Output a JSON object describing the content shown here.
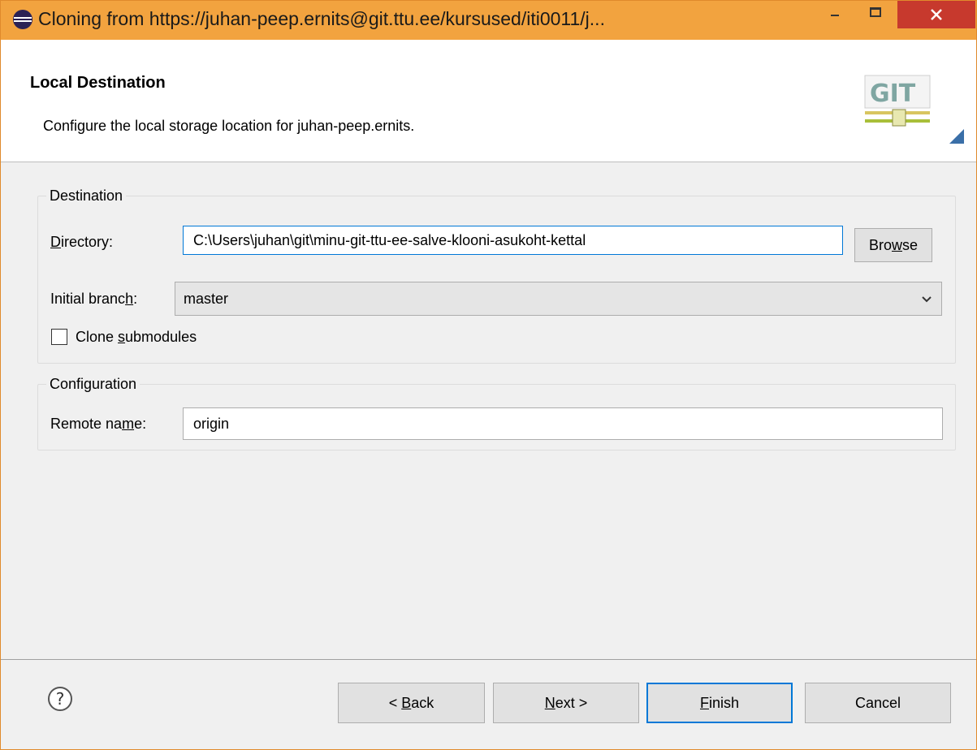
{
  "window": {
    "title": "Cloning from https://juhan-peep.ernits@git.ttu.ee/kursused/iti0011/j...",
    "colors": {
      "titlebar": "#f2a33f",
      "close": "#c7392d",
      "focus": "#0078d7"
    }
  },
  "header": {
    "title": "Local Destination",
    "description": "Configure the local storage location for juhan-peep.ernits.",
    "logo_text": "GIT"
  },
  "destination": {
    "legend": "Destination",
    "directory": {
      "label_pre": "",
      "label_key": "D",
      "label_post": "irectory:",
      "value": "C:\\Users\\juhan\\git\\minu-git-ttu-ee-salve-klooni-asukoht-kettal"
    },
    "browse": {
      "pre": "Bro",
      "key": "w",
      "post": "se"
    },
    "initial_branch": {
      "label_pre": "Initial branc",
      "label_key": "h",
      "label_post": ":",
      "value": "master"
    },
    "clone_submodules": {
      "pre": "Clone ",
      "key": "s",
      "post": "ubmodules",
      "checked": false
    }
  },
  "configuration": {
    "legend": "Configuration",
    "remote_name": {
      "label_pre": "Remote na",
      "label_key": "m",
      "label_post": "e:",
      "value": "origin"
    }
  },
  "buttons": {
    "back": {
      "pre": "< ",
      "key": "B",
      "post": "ack"
    },
    "next": {
      "pre": "",
      "key": "N",
      "post": "ext >"
    },
    "finish": {
      "pre": "",
      "key": "F",
      "post": "inish"
    },
    "cancel": {
      "label": "Cancel"
    }
  },
  "icons": {
    "app": "eclipse-icon",
    "help": "help-icon",
    "minimize": "minimize-icon",
    "maximize": "maximize-icon",
    "close": "close-icon",
    "dropdown": "chevron-down-icon"
  }
}
